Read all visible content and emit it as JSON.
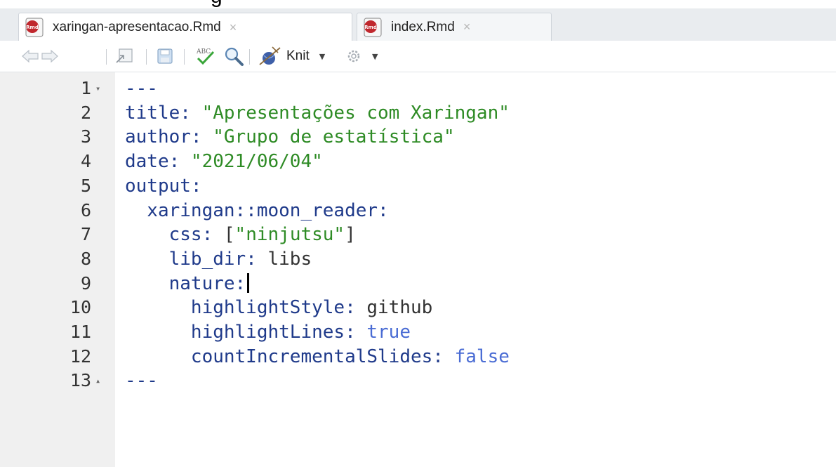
{
  "tabs": [
    {
      "label": "xaringan-apresentacao.Rmd",
      "active": true,
      "close": "×"
    },
    {
      "label": "index.Rmd",
      "active": false,
      "close": "×"
    }
  ],
  "toolbar": {
    "knit_label": "Knit",
    "icons": [
      "back-arrow-icon",
      "forward-arrow-icon",
      "show-in-window-icon",
      "save-icon",
      "spellcheck-icon",
      "search-icon",
      "knit-icon",
      "settings-gear-icon"
    ]
  },
  "top_cut_text": "g",
  "editor": {
    "lines": [
      {
        "n": "1",
        "fold": "▾",
        "parts": [
          {
            "t": "---",
            "c": "k"
          }
        ]
      },
      {
        "n": "2",
        "fold": "",
        "parts": [
          {
            "t": "title: ",
            "c": "k"
          },
          {
            "t": "\"Apresentações com Xaringan\"",
            "c": "s"
          }
        ]
      },
      {
        "n": "3",
        "fold": "",
        "parts": [
          {
            "t": "author: ",
            "c": "k"
          },
          {
            "t": "\"Grupo de estatística\"",
            "c": "s"
          }
        ]
      },
      {
        "n": "4",
        "fold": "",
        "parts": [
          {
            "t": "date: ",
            "c": "k"
          },
          {
            "t": "\"2021/06/04\"",
            "c": "s"
          }
        ]
      },
      {
        "n": "5",
        "fold": "",
        "parts": [
          {
            "t": "output:",
            "c": "k"
          }
        ]
      },
      {
        "n": "6",
        "fold": "",
        "parts": [
          {
            "t": "  xaringan::moon_reader:",
            "c": "k"
          }
        ]
      },
      {
        "n": "7",
        "fold": "",
        "parts": [
          {
            "t": "    css: ",
            "c": "k"
          },
          {
            "t": "[",
            "c": "p"
          },
          {
            "t": "\"ninjutsu\"",
            "c": "s"
          },
          {
            "t": "]",
            "c": "p"
          }
        ]
      },
      {
        "n": "8",
        "fold": "",
        "parts": [
          {
            "t": "    lib_dir: ",
            "c": "k"
          },
          {
            "t": "libs",
            "c": "plain"
          }
        ]
      },
      {
        "n": "9",
        "fold": "",
        "cursor": true,
        "parts": [
          {
            "t": "    nature:",
            "c": "k"
          }
        ]
      },
      {
        "n": "10",
        "fold": "",
        "parts": [
          {
            "t": "      highlightStyle: ",
            "c": "k"
          },
          {
            "t": "github",
            "c": "plain"
          }
        ]
      },
      {
        "n": "11",
        "fold": "",
        "parts": [
          {
            "t": "      highlightLines: ",
            "c": "k"
          },
          {
            "t": "true",
            "c": "b"
          }
        ]
      },
      {
        "n": "12",
        "fold": "",
        "parts": [
          {
            "t": "      countIncrementalSlides: ",
            "c": "k"
          },
          {
            "t": "false",
            "c": "b"
          }
        ]
      },
      {
        "n": "13",
        "fold": "▴",
        "parts": [
          {
            "t": "---",
            "c": "k"
          }
        ]
      }
    ]
  },
  "colors": {
    "keyword": "#1f3a8a",
    "string": "#2e8b25",
    "boolean": "#4a6cd4",
    "gutter": "#f0f0f0",
    "tabbar": "#e9ecef"
  }
}
